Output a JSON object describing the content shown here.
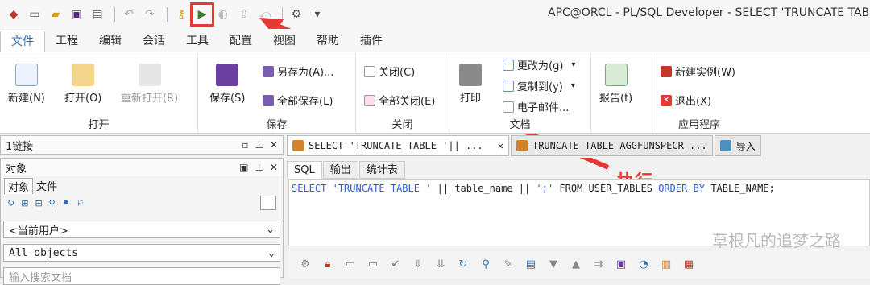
{
  "window": {
    "title": "APC@ORCL - PL/SQL Developer - SELECT 'TRUNCATE TABLE"
  },
  "menu": [
    "文件",
    "工程",
    "编辑",
    "会话",
    "工具",
    "配置",
    "视图",
    "帮助",
    "插件"
  ],
  "ribbon": {
    "open_group": {
      "label": "打开",
      "new": "新建(N)",
      "open": "打开(O)",
      "reopen": "重新打开(R)"
    },
    "save_group": {
      "label": "保存",
      "save": "保存(S)",
      "save_as": "另存为(A)...",
      "save_all": "全部保存(L)"
    },
    "close_group": {
      "label": "关闭",
      "close": "关闭(C)",
      "close_all": "全部关闭(E)"
    },
    "doc_group": {
      "label": "文档",
      "print": "打印",
      "change_to": "更改为(g)",
      "copy_to": "复制到(y)",
      "email": "电子邮件..."
    },
    "report": "报告(t)",
    "app_group": {
      "label": "应用程序",
      "new_instance": "新建实例(W)",
      "exit": "退出(X)"
    }
  },
  "left": {
    "connections": "1链接",
    "objects_title": "对象",
    "tab_objects": "对象",
    "tab_files": "文件",
    "current_user": "<当前用户>",
    "all_objects": "All objects",
    "search_placeholder": "输入搜索文档"
  },
  "tabs": {
    "doc1": "SELECT 'TRUNCATE TABLE '|| ...",
    "doc2": "TRUNCATE TABLE AGGFUNSPECR ...",
    "import": "导入"
  },
  "subtabs": [
    "SQL",
    "输出",
    "统计表"
  ],
  "sql": {
    "p1": "SELECT",
    "p2": "'TRUNCATE TABLE '",
    "p3": "|| table_name ||",
    "p4": "';'",
    "p5": "FROM USER_TABLES",
    "p6": "ORDER BY",
    "p7": "TABLE_NAME;"
  },
  "annotation": "执行",
  "watermark": "草根凡的追梦之路",
  "colors": {
    "accent": "#2b6cb0",
    "annotation": "#e53935",
    "sql_keyword": "#2a5fd4"
  }
}
